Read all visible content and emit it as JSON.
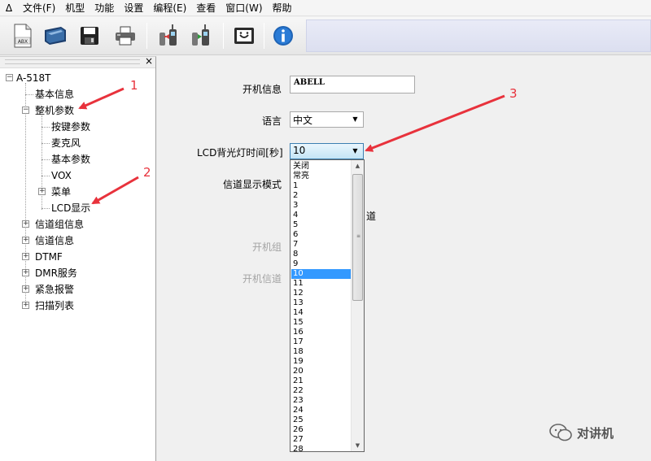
{
  "menubar": {
    "app_icon": "Δ",
    "items": [
      "文件(F)",
      "机型",
      "功能",
      "设置",
      "编程(E)",
      "查看",
      "窗口(W)",
      "帮助"
    ]
  },
  "toolbar": {
    "abx_label": "ABX",
    "icons": [
      "new-file-icon",
      "open-icon",
      "save-icon",
      "print-icon",
      "read-radio-icon",
      "write-radio-icon",
      "about-icon",
      "info-icon"
    ]
  },
  "tree": {
    "close_glyph": "×",
    "root": "A-518T",
    "items": {
      "basic_info": "基本信息",
      "whole_params": "整机参数",
      "key_params": "按键参数",
      "mic": "麦克风",
      "basic_params": "基本参数",
      "vox": "VOX",
      "menu": "菜单",
      "lcd": "LCD显示",
      "channel_group": "信道组信息",
      "channel_info": "信道信息",
      "dtmf": "DTMF",
      "dmr": "DMR服务",
      "emergency": "紧急报警",
      "scan": "扫描列表"
    }
  },
  "form": {
    "power_on_info_label": "开机信息",
    "power_on_info_value": "ABELL",
    "language_label": "语言",
    "language_value": "中文",
    "lcd_backlight_label": "LCD背光灯时间[秒]",
    "lcd_backlight_value": "10",
    "channel_display_label": "信道显示模式",
    "partial_text": "道",
    "power_on_group_label": "开机组",
    "power_on_channel_label": "开机信道"
  },
  "dropdown": {
    "options": [
      "关闭",
      "常亮",
      "1",
      "2",
      "3",
      "4",
      "5",
      "6",
      "7",
      "8",
      "9",
      "10",
      "11",
      "12",
      "13",
      "14",
      "15",
      "16",
      "17",
      "18",
      "19",
      "20",
      "21",
      "22",
      "23",
      "24",
      "25",
      "26",
      "27",
      "28"
    ],
    "selected": "10"
  },
  "annotations": {
    "n1": "1",
    "n2": "2",
    "n3": "3",
    "arrow_color": "#e8323c"
  },
  "watermark": "对讲机"
}
